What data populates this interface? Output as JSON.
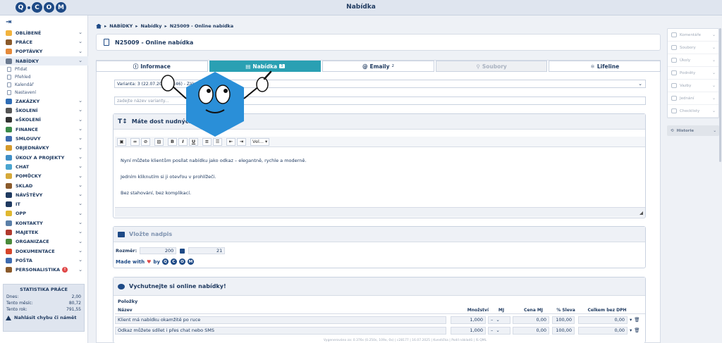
{
  "app": {
    "title": "Nabídka",
    "logo_text": "Q-COM"
  },
  "sidebar": {
    "items": [
      {
        "label": "OBLÍBENÉ",
        "color": "#f2b33d"
      },
      {
        "label": "PRÁCE",
        "color": "#8a5a2b"
      },
      {
        "label": "POPTÁVKY",
        "color": "#e58a3a"
      },
      {
        "label": "NABÍDKY",
        "color": "#6b7a90",
        "active": true
      },
      {
        "label": "ZAKÁZKY",
        "color": "#2f6db5"
      },
      {
        "label": "ŠKOLENÍ",
        "color": "#555"
      },
      {
        "label": "eŠKOLENÍ",
        "color": "#333"
      },
      {
        "label": "FINANCE",
        "color": "#3b8a4a"
      },
      {
        "label": "SMLOUVY",
        "color": "#3d6bb0"
      },
      {
        "label": "OBJEDNÁVKY",
        "color": "#d59a2c"
      },
      {
        "label": "ÚKOLY A PROJEKTY",
        "color": "#3f8fc7"
      },
      {
        "label": "CHAT",
        "color": "#4aa5d0"
      },
      {
        "label": "POMŮCKY",
        "color": "#d5a93a"
      },
      {
        "label": "SKLAD",
        "color": "#8a5a2b"
      },
      {
        "label": "NÁVŠTĚVY",
        "color": "#1f3a60"
      },
      {
        "label": "IT",
        "color": "#1f3a60"
      },
      {
        "label": "OPP",
        "color": "#e0b82f"
      },
      {
        "label": "KONTAKTY",
        "color": "#5a7fa8"
      },
      {
        "label": "MAJETEK",
        "color": "#b03a2e"
      },
      {
        "label": "ORGANIZACE",
        "color": "#4a8a3a"
      },
      {
        "label": "DOKUMENTACE",
        "color": "#d5452a"
      },
      {
        "label": "POŠTA",
        "color": "#3d6bb0"
      },
      {
        "label": "PERSONALISTIKA",
        "color": "#8a5a2b",
        "badge": "!"
      }
    ],
    "sub_items": [
      "Přidat",
      "Přehled",
      "Kalendář",
      "Nastavení"
    ],
    "stats": {
      "title": "STATISTIKA PRÁCE",
      "rows": [
        {
          "label": "Dnes:",
          "value": "2,00"
        },
        {
          "label": "Tento měsíc:",
          "value": "80,72"
        },
        {
          "label": "Tento rok:",
          "value": "791,55"
        }
      ]
    },
    "bug_report": "Nahlásit chybu či námět"
  },
  "breadcrumb": {
    "items": [
      "NABÍDKY",
      "Nabídky",
      "N25009 - Online nabídka"
    ]
  },
  "header": {
    "title": "N25009 - Online nabídka"
  },
  "tabs": [
    {
      "label": "Informace",
      "icon": "info-icon"
    },
    {
      "label": "Nabídka",
      "icon": "document-icon",
      "count": "3",
      "active": true
    },
    {
      "label": "Emaily",
      "icon": "at-icon",
      "count": "2"
    },
    {
      "label": "Soubory",
      "icon": "paperclip-icon",
      "disabled": true
    },
    {
      "label": "Lifeline",
      "icon": "lifeline-icon"
    }
  ],
  "variant": {
    "select_value": "Varianta: 3 (22.07.2025 09:46) - Zák...",
    "name_placeholder": "zadejte název varianty..."
  },
  "editor": {
    "title": "Máte dost nudných...",
    "toolbar": [
      "B",
      "I",
      "U"
    ],
    "font_select": "Vel...",
    "paragraphs": [
      "Nyní můžete klientům posílat nabídku jako odkaz – elegantně, rychle a moderně.",
      "Jedním kliknutím si ji otevřou v prohlížeči.",
      "Bez stahování, bez komplikací."
    ]
  },
  "image_panel": {
    "title": "Vložte nadpis",
    "size_label": "Rozměr:",
    "width": "200",
    "height": "21",
    "made_with": "Made with",
    "by": "by"
  },
  "offer_panel": {
    "title": "Vychutnejte si online nabídky!",
    "items_label": "Položky",
    "columns": [
      "Název",
      "Množství",
      "MJ",
      "Cena MJ",
      "% Sleva",
      "Celkem bez DPH"
    ],
    "rows": [
      {
        "name": "Klient má nabídku okamžitě po ruce",
        "qty": "1,000",
        "unit": "–",
        "price": "0,00",
        "discount": "100,00",
        "total": "0,00"
      },
      {
        "name": "Odkaz můžete sdílet i přes chat nebo SMS",
        "qty": "1,000",
        "unit": "–",
        "price": "0,00",
        "discount": "100,00",
        "total": "0,00"
      }
    ]
  },
  "right_panel": {
    "items": [
      "Komentáře",
      "Soubory",
      "Úkoly",
      "Podněty",
      "Vazby",
      "Jednání",
      "Checklisty"
    ],
    "history": "Historie"
  },
  "footer": "Vygenerováno za: 0.376s (0.250s, 109x, 0x) | c28177 | 16.07.2025 | Kvestička | Podíl nákladů | IS QML"
}
